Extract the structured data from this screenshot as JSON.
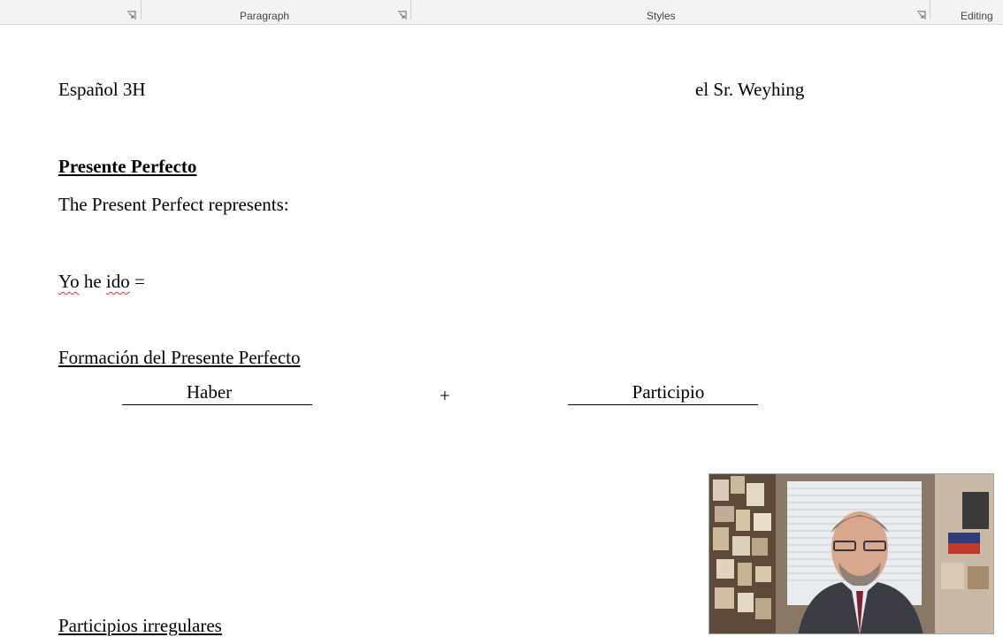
{
  "ribbon": {
    "paragraph_label": "Paragraph",
    "styles_label": "Styles",
    "editing_label": "Editing"
  },
  "document": {
    "class_name": "Español 3H",
    "teacher": "el Sr. Weyhing",
    "title": "Presente Perfecto",
    "represents_line": "The Present Perfect represents:",
    "example": {
      "yo": "Yo",
      "he": "he",
      "ido": "ido",
      "equals": "="
    },
    "formation_heading": "Formación del Presente Perfecto",
    "haber": "Haber",
    "plus": "+",
    "participio": "Participio",
    "irregular_heading": "Participios irregulares"
  },
  "webcam": {
    "icon": "video-feed"
  }
}
